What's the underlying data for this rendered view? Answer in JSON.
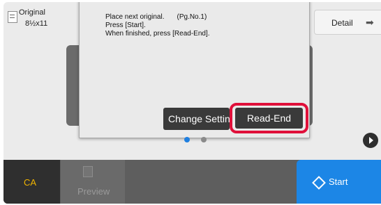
{
  "original": {
    "label": "Original",
    "size": "8½x11"
  },
  "detail": {
    "label": "Detail",
    "arrow": "➡"
  },
  "dialog": {
    "line1": "Place next original.",
    "page_no": "(Pg.No.1)",
    "line2": "Press [Start].",
    "line3": "When finished, press [Read-End].",
    "change_settings_label": "Change Settin",
    "read_end_label": "Read-End"
  },
  "pagination": {
    "current": 1,
    "total": 2
  },
  "bottom": {
    "ca_label": "CA",
    "preview_label": "Preview",
    "start_label": "Start"
  },
  "colors": {
    "accent": "#1c86e6",
    "highlight": "#e0103a",
    "ca_text": "#f0b400"
  }
}
